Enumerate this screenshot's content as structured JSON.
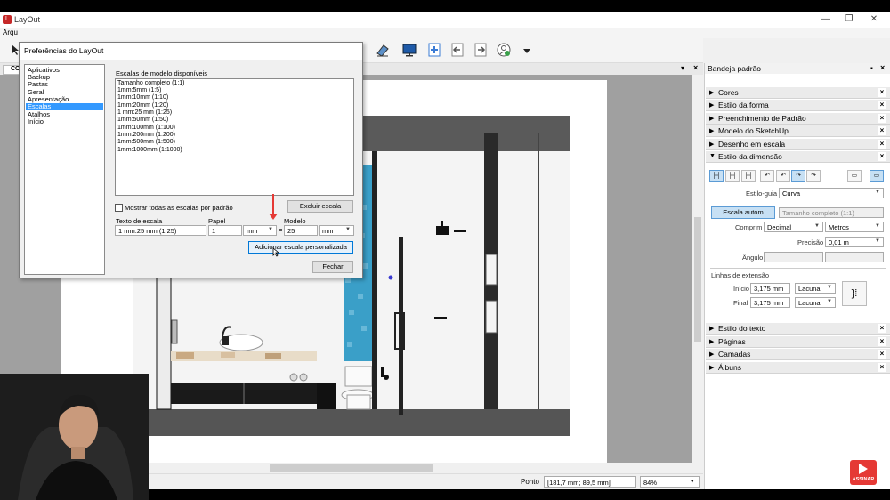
{
  "window": {
    "title": "LayOut",
    "min": "—",
    "max": "❐",
    "close": "✕"
  },
  "menu": {
    "file": "Arqu"
  },
  "document_tab": "CO",
  "dialog": {
    "title": "Preferências do LayOut",
    "categories": [
      "Aplicativos",
      "Backup",
      "Pastas",
      "Geral",
      "Apresentação",
      "Escalas",
      "Atalhos",
      "Início"
    ],
    "selected_category": "Escalas",
    "scales_label": "Escalas de modelo disponíveis",
    "scales": [
      "Tamanho completo (1:1)",
      "1mm:5mm (1:5)",
      "1mm:10mm (1:10)",
      "1mm:20mm (1:20)",
      "1 mm:25 mm (1:25)",
      "1mm:50mm (1:50)",
      "1mm:100mm (1:100)",
      "1mm:200mm (1:200)",
      "1mm:500mm (1:500)",
      "1mm:1000mm (1:1000)"
    ],
    "show_all_label": "Mostrar todas as escalas por padrão",
    "delete_button": "Excluir escala",
    "scale_text_label": "Texto de escala",
    "scale_text_value": "1 mm:25 mm (1:25)",
    "paper_label": "Papel",
    "paper_value": "1",
    "paper_unit": "mm",
    "equals": "=",
    "model_label": "Modelo",
    "model_value": "25",
    "model_unit": "mm",
    "add_button": "Adicionar escala personalizada",
    "close_button": "Fechar"
  },
  "tray": {
    "title": "Bandeja padrão",
    "sections": [
      {
        "label": "Cores",
        "expanded": false
      },
      {
        "label": "Estilo da forma",
        "expanded": false
      },
      {
        "label": "Preenchimento de Padrão",
        "expanded": false
      },
      {
        "label": "Modelo do SketchUp",
        "expanded": false
      },
      {
        "label": "Desenho em escala",
        "expanded": false
      },
      {
        "label": "Estilo da dimensão",
        "expanded": true
      }
    ],
    "sections_bottom": [
      {
        "label": "Estilo do texto"
      },
      {
        "label": "Páginas"
      },
      {
        "label": "Camadas"
      },
      {
        "label": "Álbuns"
      }
    ],
    "dimension": {
      "guide_style_label": "Estilo-guia",
      "guide_style_value": "Curva",
      "auto_scale_button": "Escala autom",
      "scale_value": "Tamanho completo (1:1)",
      "length_label": "Comprim",
      "length_format": "Decimal",
      "length_unit": "Metros",
      "precision_label": "Precisão",
      "precision_value": "0,01 m",
      "angle_label": "Ângulo",
      "extension_label": "Linhas de extensão",
      "start_label": "Início",
      "start_value": "3,175 mm",
      "start_type": "Lacuna",
      "end_label": "Final",
      "end_value": "3,175 mm",
      "end_type": "Lacuna"
    }
  },
  "status": {
    "point_label": "Ponto",
    "coords": "[181,7 mm; 89,5 mm]",
    "zoom": "84%"
  },
  "subscribe": "ASSINAR",
  "colors": {
    "accent": "#3399ff",
    "mosaic": "#3a9fc8",
    "arrow": "#e53935"
  }
}
